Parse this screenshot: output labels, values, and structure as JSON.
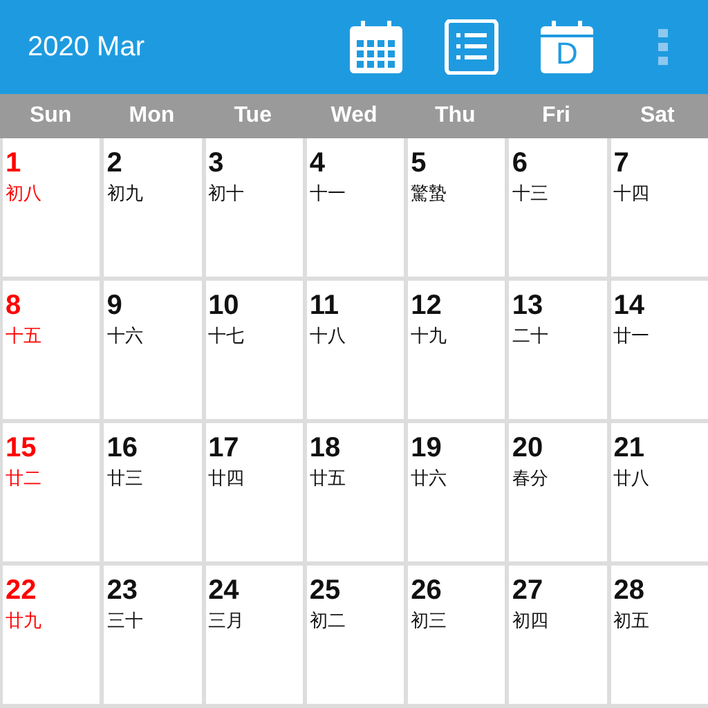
{
  "app_bar": {
    "title": "2020 Mar",
    "day_view_letter": "D"
  },
  "weekdays": [
    "Sun",
    "Mon",
    "Tue",
    "Wed",
    "Thu",
    "Fri",
    "Sat"
  ],
  "weeks": [
    [
      {
        "day": "1",
        "lunar": "初八",
        "sunday": true
      },
      {
        "day": "2",
        "lunar": "初九",
        "sunday": false
      },
      {
        "day": "3",
        "lunar": "初十",
        "sunday": false
      },
      {
        "day": "4",
        "lunar": "十一",
        "sunday": false
      },
      {
        "day": "5",
        "lunar": "驚蟄",
        "sunday": false
      },
      {
        "day": "6",
        "lunar": "十三",
        "sunday": false
      },
      {
        "day": "7",
        "lunar": "十四",
        "sunday": false
      }
    ],
    [
      {
        "day": "8",
        "lunar": "十五",
        "sunday": true
      },
      {
        "day": "9",
        "lunar": "十六",
        "sunday": false
      },
      {
        "day": "10",
        "lunar": "十七",
        "sunday": false
      },
      {
        "day": "11",
        "lunar": "十八",
        "sunday": false
      },
      {
        "day": "12",
        "lunar": "十九",
        "sunday": false
      },
      {
        "day": "13",
        "lunar": "二十",
        "sunday": false
      },
      {
        "day": "14",
        "lunar": "廿一",
        "sunday": false
      }
    ],
    [
      {
        "day": "15",
        "lunar": "廿二",
        "sunday": true
      },
      {
        "day": "16",
        "lunar": "廿三",
        "sunday": false
      },
      {
        "day": "17",
        "lunar": "廿四",
        "sunday": false
      },
      {
        "day": "18",
        "lunar": "廿五",
        "sunday": false
      },
      {
        "day": "19",
        "lunar": "廿六",
        "sunday": false
      },
      {
        "day": "20",
        "lunar": "春分",
        "sunday": false
      },
      {
        "day": "21",
        "lunar": "廿八",
        "sunday": false
      }
    ],
    [
      {
        "day": "22",
        "lunar": "廿九",
        "sunday": true
      },
      {
        "day": "23",
        "lunar": "三十",
        "sunday": false
      },
      {
        "day": "24",
        "lunar": "三月",
        "sunday": false
      },
      {
        "day": "25",
        "lunar": "初二",
        "sunday": false
      },
      {
        "day": "26",
        "lunar": "初三",
        "sunday": false
      },
      {
        "day": "27",
        "lunar": "初四",
        "sunday": false
      },
      {
        "day": "28",
        "lunar": "初五",
        "sunday": false
      }
    ]
  ]
}
